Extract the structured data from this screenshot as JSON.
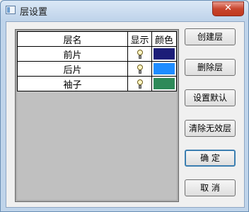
{
  "window": {
    "title": "层设置",
    "close_label": "✕"
  },
  "table": {
    "headers": {
      "name": "层名",
      "show": "显示",
      "color": "颜色"
    },
    "rows": [
      {
        "name": "前片",
        "visible": true,
        "color": "#1c1d78"
      },
      {
        "name": "后片",
        "visible": true,
        "color": "#1e8cff"
      },
      {
        "name": "袖子",
        "visible": true,
        "color": "#2e8a59"
      }
    ]
  },
  "buttons": {
    "create": "创建层",
    "delete": "删除层",
    "set_default": "设置默认",
    "clear_invalid": "清除无效层",
    "ok": "确 定",
    "cancel": "取 消"
  }
}
